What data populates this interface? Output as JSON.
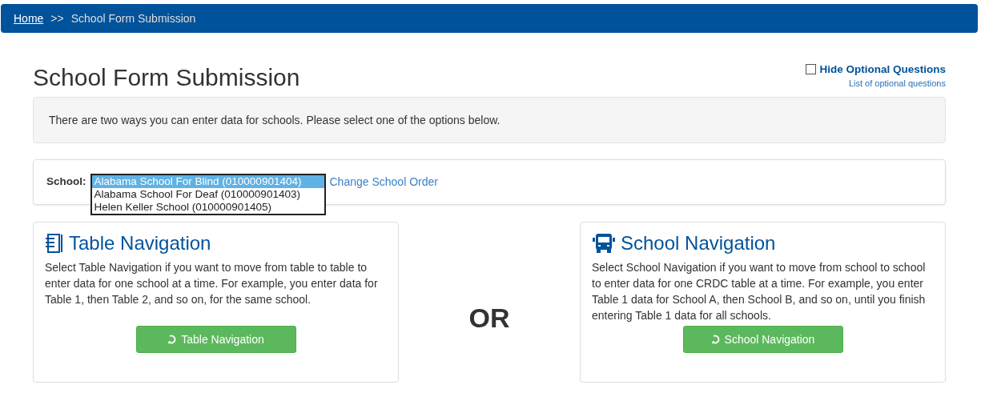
{
  "breadcrumb": {
    "home": "Home",
    "separator": ">>",
    "current": "School Form Submission"
  },
  "title": "School Form Submission",
  "hide_optional": {
    "label": "Hide Optional Questions",
    "checked": false
  },
  "optional_list_link": "List of optional questions",
  "info": "There are two ways you can enter data for schools. Please select one of the options below.",
  "school_select": {
    "label": "School:",
    "options": [
      {
        "text": "Alabama School For Blind (010000901404)",
        "selected": true
      },
      {
        "text": "Alabama School For Deaf (010000901403)",
        "selected": false
      },
      {
        "text": "Helen Keller School (010000901405)",
        "selected": false
      }
    ],
    "link": "Change School Order"
  },
  "options": [
    {
      "kind": "table",
      "title": "Table Navigation",
      "description": "Select Table Navigation if you want to move from table to table to enter data for one school at a time. For example, you enter data for Table 1, then Table 2, and so on, for the same school.",
      "button": "Table Navigation"
    },
    {
      "kind": "school",
      "title": "School Navigation",
      "description": "Select School Navigation if you want to move from school to school to enter data for one CRDC table at a time. For example, you enter Table 1 data for School A, then School B, and so on, until you finish entering Table 1 data for all schools.",
      "button": "School Navigation"
    }
  ],
  "or_label": "OR"
}
